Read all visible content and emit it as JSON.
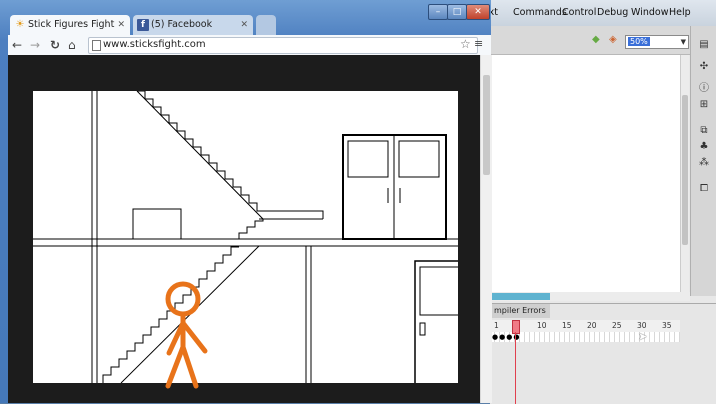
{
  "ide": {
    "menu": [
      "ext",
      "Commands",
      "Control",
      "Debug",
      "Window",
      "Help"
    ],
    "zoom": "50%",
    "timeline_tab": "mpiler Errors",
    "ruler": [
      "1",
      "5",
      "10",
      "15",
      "20",
      "25",
      "30",
      "35"
    ],
    "frame_dots": "●●●●"
  },
  "chrome": {
    "tabs": [
      {
        "label": "Stick Figures Fight",
        "favicon": "☀"
      },
      {
        "label": "(5) Facebook",
        "favicon": "f"
      }
    ],
    "url": "www.sticksfight.com",
    "nav": {
      "back": "←",
      "forward": "→",
      "reload": "↻",
      "home": "⌂"
    },
    "menu_icon": "≡",
    "star_icon": "☆",
    "win": {
      "min": "–",
      "max": "□",
      "close": "✕"
    }
  },
  "colors": {
    "stick_figure": "#e8731a",
    "chrome_frame": "#4d7fc0"
  }
}
